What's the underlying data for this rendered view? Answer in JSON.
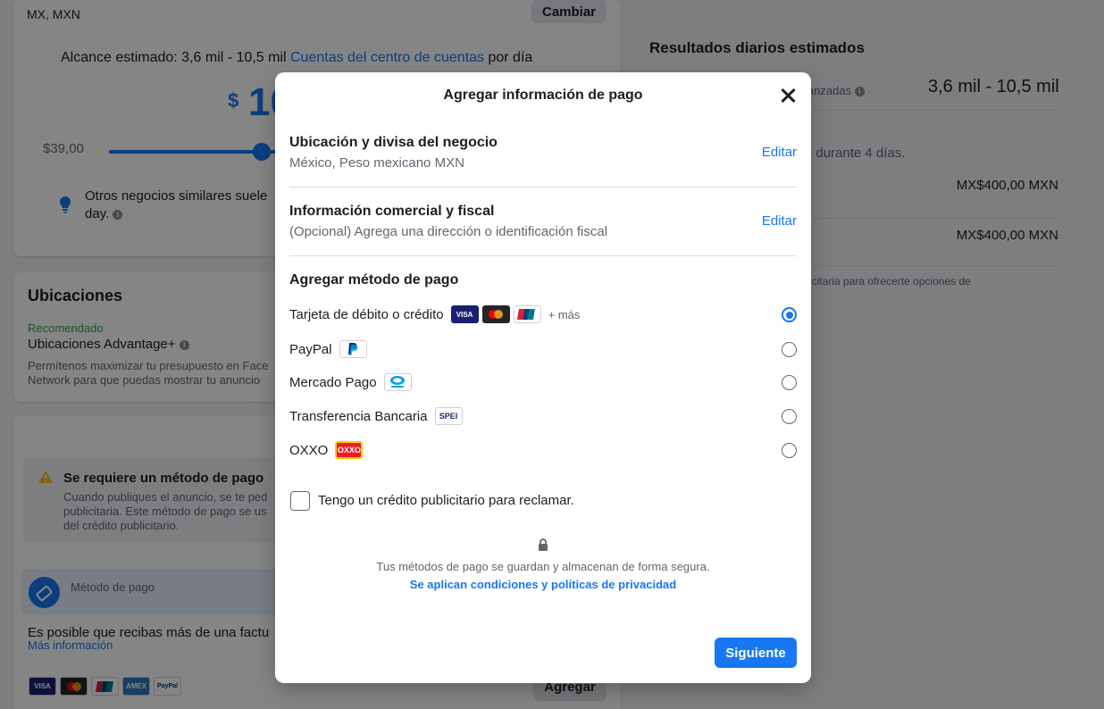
{
  "background": {
    "region": "MX, MXN",
    "change_button": "Cambiar",
    "reach_prefix": "Alcance estimado: 3,6 mil - 10,5 mil",
    "reach_link": "Cuentas del centro de cuentas",
    "reach_suffix": "por día",
    "currency_symbol": "$",
    "budget_partial": "10",
    "min_budget": "$39,00",
    "tip_text": "Otros negocios similares suele",
    "tip_text2": "day.",
    "placements_title": "Ubicaciones",
    "recommended": "Recomendado",
    "advantage": "Ubicaciones Advantage+",
    "advantage_desc": "Permítenos maximizar tu presupuesto en Face Network para que puedas mostrar tu anuncio",
    "payment_required_title": "Se requiere un método de pago",
    "payment_required_desc": "Cuando publiques el anuncio, se te ped publicitaria. Este método de pago se us del crédito publicitario.",
    "payment_method_label": "Método de pago",
    "possible_text": "Es posible que recibas más de una factu",
    "more_info": "Más información",
    "add_button": "Agregar",
    "results_title": "Resultados diarios estimados",
    "results_label": "as alcanzadas",
    "results_value": "3,6 mil - 10,5 mil",
    "days_text": "lación durante 4 días.",
    "amount1": "MX$400,00 MXN",
    "small_s": "s.",
    "amount2": "MX$400,00 MXN",
    "foot_note": "ta publicitaria para ofrecerte opciones de",
    "card_logos": [
      "VISA",
      "MC",
      "UP",
      "AMEX",
      "PayPal"
    ]
  },
  "modal": {
    "title": "Agregar información de pago",
    "location": {
      "title": "Ubicación y divisa del negocio",
      "value": "México, Peso mexicano MXN",
      "edit": "Editar"
    },
    "business": {
      "title": "Información comercial y fiscal",
      "value": "(Opcional) Agrega una dirección o identificación fiscal",
      "edit": "Editar"
    },
    "payment_methods_title": "Agregar método de pago",
    "methods": [
      {
        "label": "Tarjeta de débito o crédito",
        "extra": "+ más",
        "selected": true
      },
      {
        "label": "PayPal",
        "selected": false
      },
      {
        "label": "Mercado Pago",
        "selected": false
      },
      {
        "label": "Transferencia Bancaria",
        "selected": false
      },
      {
        "label": "OXXO",
        "selected": false
      }
    ],
    "logos": {
      "visa": "VISA",
      "paypal": "PayPal",
      "mercado": "mercado pago",
      "spei": "SPEI",
      "oxxo": "OXXO"
    },
    "credit_checkbox": "Tengo un crédito publicitario para reclamar.",
    "secure_text": "Tus métodos de pago se guardan y almacenan de forma segura.",
    "terms_link": "Se aplican condiciones y políticas de privacidad",
    "next_button": "Siguiente"
  },
  "colors": {
    "accent": "#1877f2",
    "overlay": "rgba(0,0,0,0.48)",
    "recommended": "#31a24c",
    "warning": "#f7b928"
  }
}
